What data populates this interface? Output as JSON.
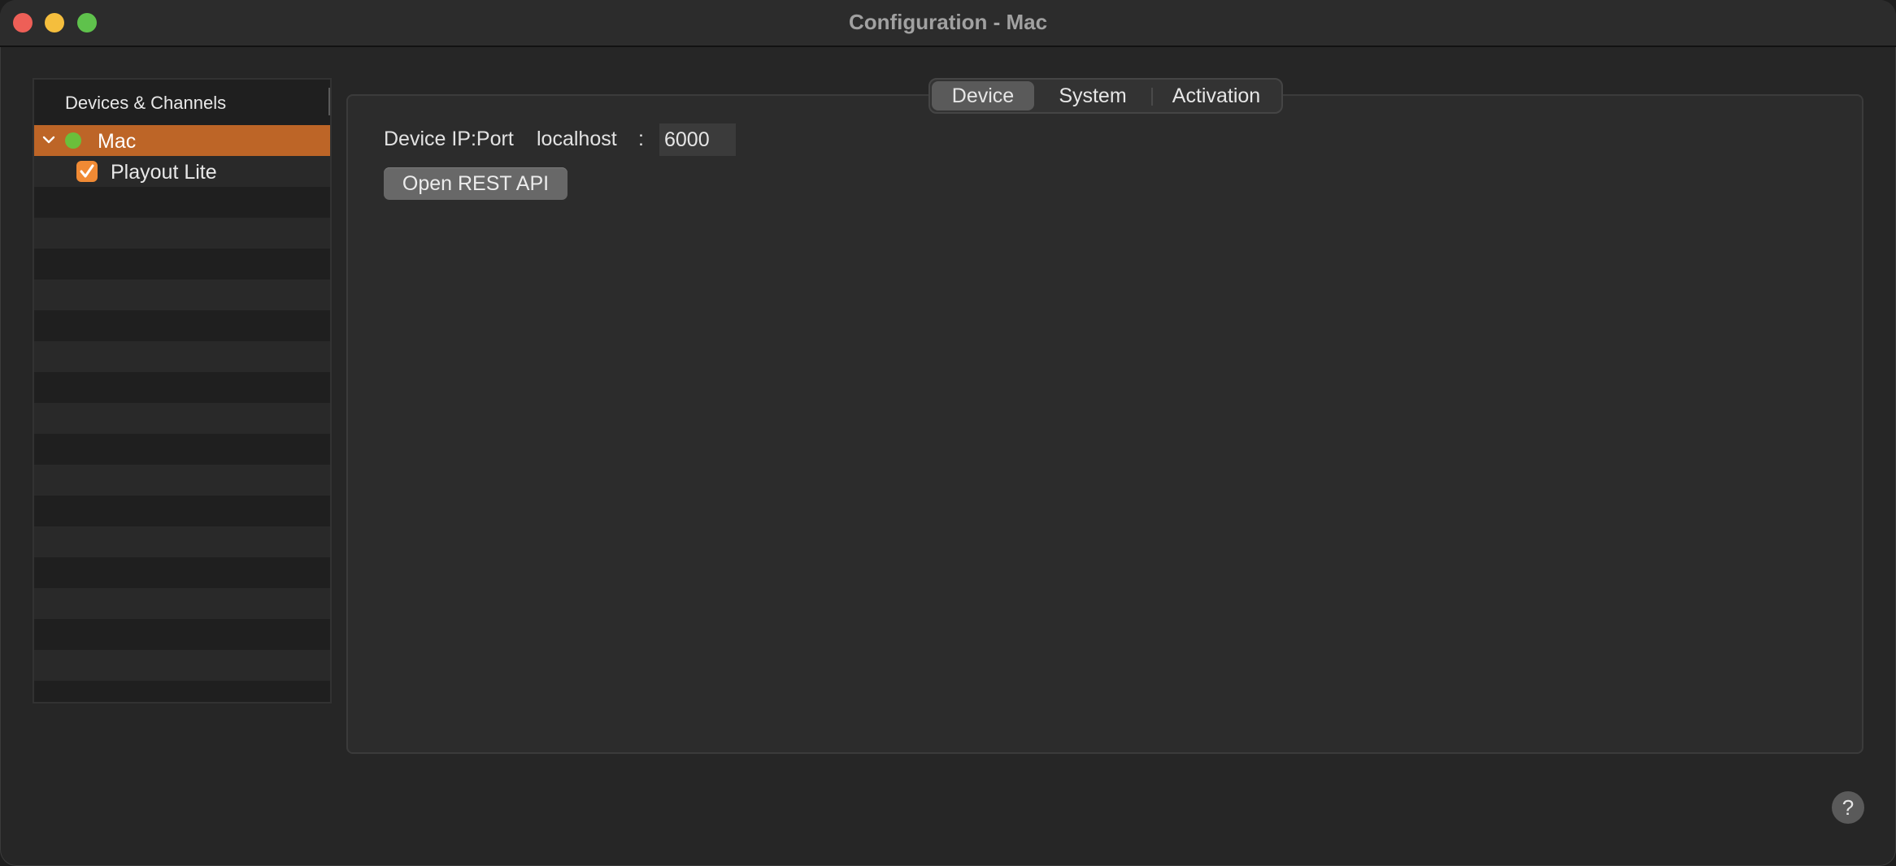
{
  "window": {
    "title": "Configuration - Mac",
    "controls": [
      "close",
      "minimize",
      "maximize"
    ]
  },
  "sidebar": {
    "header": "Devices & Channels",
    "items": [
      {
        "label": "Mac",
        "expanded": true,
        "status": "online",
        "selected": true,
        "icon": "chevron-down-icon"
      },
      {
        "label": "Playout Lite",
        "checked": true,
        "icon": "checkbox-icon"
      }
    ]
  },
  "tabs": [
    {
      "label": "Device",
      "selected": true
    },
    {
      "label": "System",
      "selected": false
    },
    {
      "label": "Activation",
      "selected": false
    }
  ],
  "device": {
    "ip_port_label": "Device IP:Port",
    "host": "localhost",
    "separator": ":",
    "port": "6000",
    "open_rest_api_label": "Open REST API"
  },
  "help": {
    "label": "?"
  },
  "colors": {
    "selection": "#bd6527",
    "status_online": "#6bbf3b",
    "checkbox": "#f08a34"
  }
}
